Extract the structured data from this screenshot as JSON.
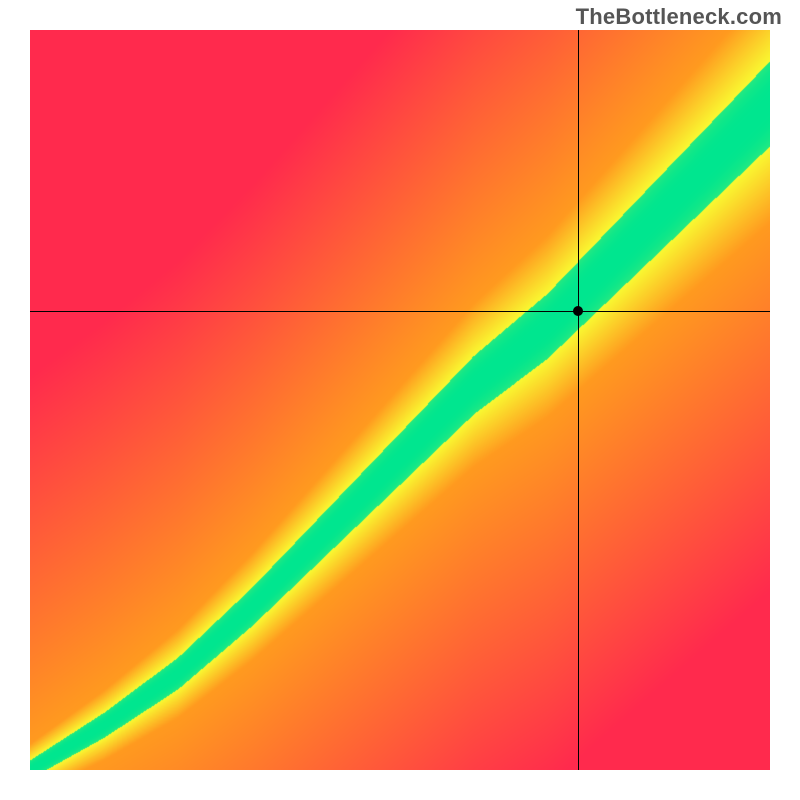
{
  "attribution": "TheBottleneck.com",
  "chart_data": {
    "type": "heatmap",
    "title": "",
    "xlabel": "",
    "ylabel": "",
    "xlim": [
      0,
      1
    ],
    "ylim": [
      0,
      1
    ],
    "marker": {
      "x": 0.74,
      "y": 0.62
    },
    "crosshair": {
      "x": 0.74,
      "y": 0.62
    },
    "optimal_band": {
      "description": "green diagonal band representing balanced pairing; yellow transition; red/orange mismatch regions",
      "centerline_points": [
        {
          "x": 0.0,
          "y": 0.0
        },
        {
          "x": 0.1,
          "y": 0.06
        },
        {
          "x": 0.2,
          "y": 0.13
        },
        {
          "x": 0.3,
          "y": 0.22
        },
        {
          "x": 0.4,
          "y": 0.32
        },
        {
          "x": 0.5,
          "y": 0.42
        },
        {
          "x": 0.6,
          "y": 0.52
        },
        {
          "x": 0.7,
          "y": 0.6
        },
        {
          "x": 0.8,
          "y": 0.7
        },
        {
          "x": 0.9,
          "y": 0.8
        },
        {
          "x": 1.0,
          "y": 0.9
        }
      ],
      "green_half_width": 0.05,
      "yellow_half_width": 0.14
    },
    "colors": {
      "best": "#00e68f",
      "good": "#f9f931",
      "mid": "#ff9a1f",
      "bad": "#ff2a4d"
    }
  }
}
